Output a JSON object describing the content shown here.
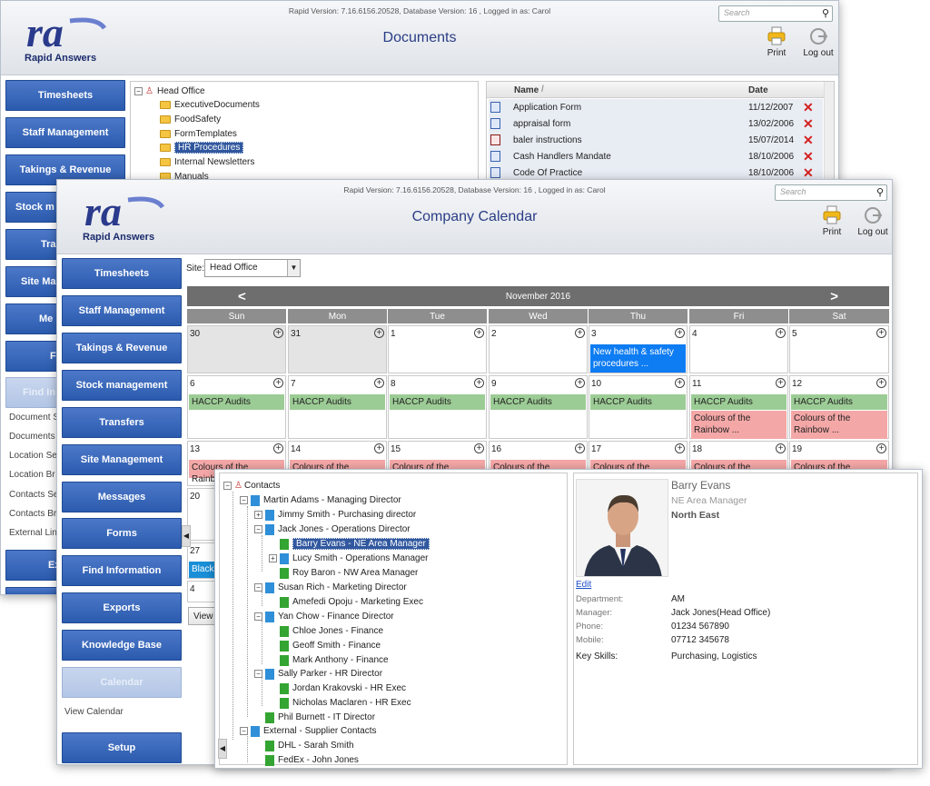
{
  "header": {
    "version_text": "Rapid Version: 7.16.6156.20528, Database Version: 16 , Logged in as: Carol",
    "search_placeholder": "Search",
    "print_label": "Print",
    "logout_label": "Log out",
    "logo_text": "Rapid Answers",
    "logo_mark": "ra"
  },
  "documents_window": {
    "title": "Documents",
    "nav": [
      "Timesheets",
      "Staff Management",
      "Takings & Revenue",
      "Stock m",
      "Tra",
      "Site Ma",
      "Me",
      "F",
      "Find In",
      "Ex"
    ],
    "sublinks": [
      "Document S",
      "Documents",
      "Location Se",
      "Location Br",
      "Contacts Se",
      "Contacts Br",
      "External Lin"
    ],
    "tree": {
      "root": "Head Office",
      "folders": [
        "ExecutiveDocuments",
        "FoodSafety",
        "FormTemplates",
        "HR Procedures",
        "Internal Newsletters",
        "Manuals"
      ]
    },
    "grid": {
      "col_name": "Name",
      "col_date": "Date",
      "rows": [
        {
          "name": "Application Form",
          "date": "11/12/2007",
          "icon": "word-doc-icon"
        },
        {
          "name": "appraisal form",
          "date": "13/02/2006",
          "icon": "word-doc-icon"
        },
        {
          "name": "baler instructions",
          "date": "15/07/2014",
          "icon": "pdf-icon"
        },
        {
          "name": "Cash Handlers Mandate",
          "date": "18/10/2006",
          "icon": "word-doc-icon"
        },
        {
          "name": "Code Of Practice",
          "date": "18/10/2006",
          "icon": "word-doc-icon"
        }
      ]
    }
  },
  "calendar_window": {
    "title": "Company Calendar",
    "nav": [
      "Timesheets",
      "Staff Management",
      "Takings & Revenue",
      "Stock management",
      "Transfers",
      "Site Management",
      "Messages",
      "Forms",
      "Find Information",
      "Exports",
      "Knowledge Base",
      "Calendar",
      "Setup"
    ],
    "sublink": "View Calendar",
    "site_label": "Site:",
    "site_value": "Head Office",
    "month": "November 2016",
    "prev": "<",
    "next": ">",
    "days": [
      "Sun",
      "Mon",
      "Tue",
      "Wed",
      "Thu",
      "Fri",
      "Sat"
    ],
    "week1": [
      "30",
      "31",
      "1",
      "2",
      "3",
      "4",
      "5"
    ],
    "week2": [
      "6",
      "7",
      "8",
      "9",
      "10",
      "11",
      "12"
    ],
    "week3": [
      "13",
      "14",
      "15",
      "16",
      "17",
      "18",
      "19"
    ],
    "week4_first": "20",
    "week5_first": "27",
    "week6_first": "4",
    "event_thu3": "New health & safety procedures ...",
    "event_haccp": "HACCP Audits",
    "event_rainbow": "Colours of the Rainbow ...",
    "event_rainbow_short": "Colours of the Rainbow",
    "event_black": "Black",
    "view_btn": "View"
  },
  "contacts_panel": {
    "root": "Contacts",
    "nodes": [
      "Martin Adams - Managing Director",
      "Jimmy Smith - Purchasing director",
      "Jack Jones - Operations Director",
      "Barry Evans - NE Area Manager",
      "Lucy Smith - Operations Manager",
      "Roy Baron - NW Area Manager",
      "Susan Rich - Marketing Director",
      "Amefedi Opoju - Marketing Exec",
      "Yan Chow - Finance Director",
      "Chloe Jones - Finance",
      "Geoff Smith - Finance",
      "Mark Anthony - Finance",
      "Sally Parker - HR Director",
      "Jordan Krakovski - HR Exec",
      "Nicholas Maclaren - HR Exec",
      "Phil Burnett - IT Director",
      "External - Supplier Contacts",
      "DHL - Sarah Smith",
      "FedEx - John Jones"
    ],
    "detail": {
      "name": "Barry Evans",
      "role": "NE Area Manager",
      "region": "North East",
      "edit": "Edit",
      "department_label": "Department:",
      "department": "AM",
      "manager_label": "Manager:",
      "manager": "Jack Jones(Head Office)",
      "phone_label": "Phone:",
      "phone": "01234 567890",
      "mobile_label": "Mobile:",
      "mobile": "07712 345678",
      "skills_label": "Key Skills:",
      "skills": "Purchasing, Logistics"
    }
  },
  "colors": {
    "nav_blue": "#2b5bae",
    "title_blue": "#2a3d86",
    "haccp_green": "#9ccc95",
    "rainbow_pink": "#f4a7a7",
    "event_blue": "#0e7cf2",
    "delete_red": "#d42020"
  }
}
